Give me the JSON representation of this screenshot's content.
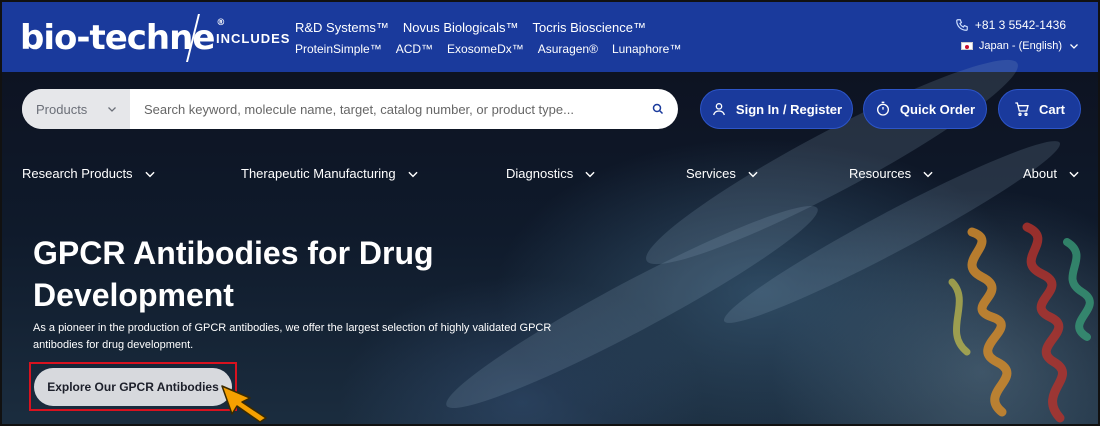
{
  "brand": {
    "logo_text": "bio-techne",
    "logo_mark": "®",
    "includes_label": "INCLUDES",
    "brands_row1": [
      "R&D Systems™",
      "Novus Biologicals™",
      "Tocris Bioscience™"
    ],
    "brands_row2": [
      "ProteinSimple™",
      "ACD™",
      "ExosomeDx™",
      "Asuragen®",
      "Lunaphore™"
    ],
    "phone": "+81 3 5542-1436",
    "locale": "Japan - (English)"
  },
  "search": {
    "category": "Products",
    "placeholder": "Search keyword, molecule name, target, catalog number, or product type..."
  },
  "actions": {
    "signin": "Sign In / Register",
    "quick_order": "Quick Order",
    "cart": "Cart"
  },
  "nav": {
    "items": [
      "Research Products",
      "Therapeutic Manufacturing",
      "Diagnostics",
      "Services",
      "Resources",
      "About"
    ]
  },
  "hero": {
    "title": "GPCR Antibodies for Drug Development",
    "subtitle": "As a pioneer in the production of GPCR antibodies, we offer the largest selection of highly validated GPCR antibodies for drug development.",
    "cta": "Explore Our GPCR Antibodies"
  },
  "colors": {
    "brand_blue": "#1a3a9c",
    "highlight_red": "#d8121f",
    "cursor_orange": "#f5a000"
  }
}
